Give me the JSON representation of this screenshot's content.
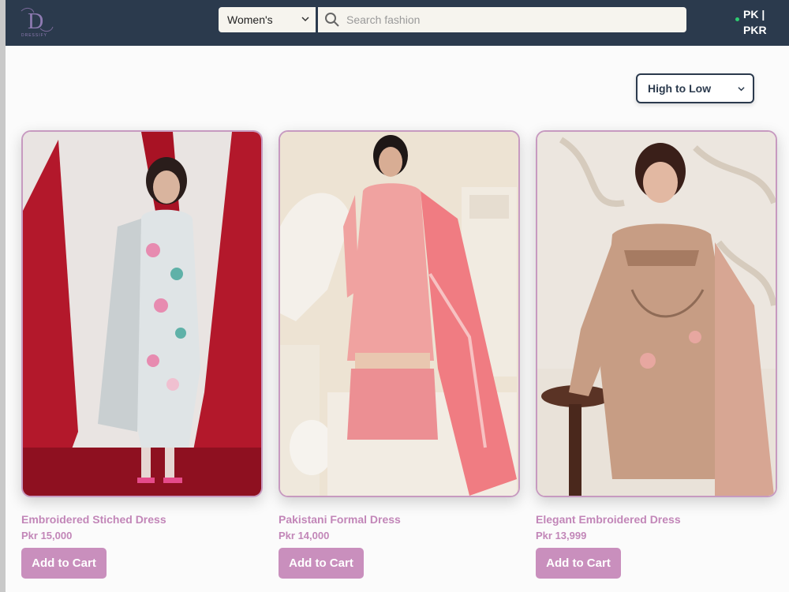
{
  "header": {
    "logo_letter": "D",
    "logo_text": "DRESSIFY",
    "category_select": {
      "value": "Women's"
    },
    "search": {
      "placeholder": "Search fashion"
    },
    "region": {
      "line1": "PK |",
      "line2": "PKR"
    }
  },
  "sort": {
    "value": "High to Low"
  },
  "products": [
    {
      "name": "Embroidered Stiched Dress",
      "price": "Pkr 15,000",
      "button": "Add to Cart"
    },
    {
      "name": "Pakistani Formal Dress",
      "price": "Pkr 14,000",
      "button": "Add to Cart"
    },
    {
      "name": "Elegant Embroidered Dress",
      "price": "Pkr 13,999",
      "button": "Add to Cart"
    }
  ],
  "colors": {
    "navbar": "#2b3a4d",
    "accent": "#c98fbd",
    "product_text": "#c286b8"
  }
}
